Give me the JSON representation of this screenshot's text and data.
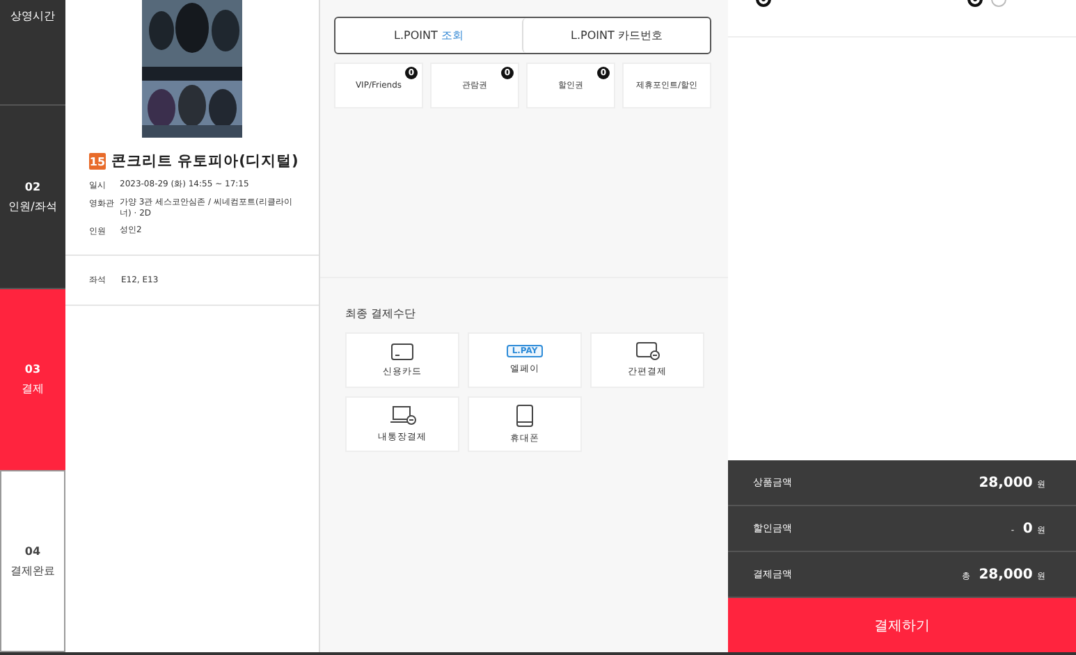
{
  "steps": [
    {
      "label": "상영시간",
      "completed": true,
      "selected": false
    },
    {
      "number": "02",
      "label": "인원/좌석",
      "completed": true,
      "selected": false
    },
    {
      "number": "03",
      "label": "결제",
      "completed": false,
      "selected": true
    },
    {
      "number": "04",
      "label": "결제완료",
      "completed": false,
      "selected": false
    }
  ],
  "movie": {
    "rating": "15",
    "title": "콘크리트 유토피아(디지털)",
    "details": [
      {
        "label": "일시",
        "value": "2023-08-29 (화) 14:55 ~ 17:15"
      },
      {
        "label": "영화관",
        "value": "가양 3관 세스코안심존 / 씨네컴포트(리클라이너) · 2D"
      },
      {
        "label": "인원",
        "value": "성인2"
      }
    ],
    "seats": {
      "label": "좌석",
      "value": "E12, E13"
    }
  },
  "lpoint_tabs": [
    {
      "label": "L.POINT ",
      "highlight": "조회"
    },
    {
      "label": "L.POINT 카드번호"
    }
  ],
  "discounts": [
    {
      "label": "VIP/Friends",
      "badge": "0"
    },
    {
      "label": "관람권",
      "badge": "0"
    },
    {
      "label": "할인권",
      "badge": "0"
    },
    {
      "label": "제휴포인트/할인"
    }
  ],
  "payment": {
    "title": "최종 결제수단",
    "methods": [
      {
        "kind": "card",
        "label": "신용카드"
      },
      {
        "kind": "lpay",
        "label": "엘페이",
        "logo": "L.PAY"
      },
      {
        "kind": "easy",
        "label": "간편결제"
      },
      {
        "kind": "laptop",
        "label": "내통장결제"
      },
      {
        "kind": "phone",
        "label": "휴대폰"
      }
    ]
  },
  "earn_options": [
    {
      "selected": true
    },
    {
      "selected": true
    },
    {
      "selected": false
    }
  ],
  "summary": [
    {
      "label": "상품금액",
      "amount": "28,000",
      "unit": "원"
    },
    {
      "label": "할인금액",
      "prefix": "-",
      "amount": "0",
      "unit": "원"
    },
    {
      "label": "결제금액",
      "prefix": "총",
      "amount": "28,000",
      "unit": "원"
    }
  ],
  "pay_button": "결제하기"
}
